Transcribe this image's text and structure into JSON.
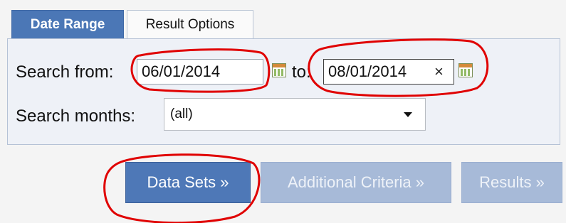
{
  "tabs": {
    "date_range": "Date Range",
    "result_options": "Result Options"
  },
  "date_form": {
    "search_from_label": "Search from:",
    "from_value": "06/01/2014",
    "to_label": "to:",
    "to_value": "08/01/2014",
    "clear_glyph": "×",
    "search_months_label": "Search months:",
    "months_selected": "(all)"
  },
  "buttons": {
    "data_sets": "Data Sets »",
    "additional_criteria": "Additional Criteria »",
    "results": "Results »"
  },
  "colors": {
    "accent": "#4b77b6",
    "disabled": "#a7bad8",
    "annotation": "#e00000"
  },
  "icons": {
    "calendar": "calendar-icon",
    "clear": "clear-icon",
    "dropdown": "chevron-down-icon"
  }
}
